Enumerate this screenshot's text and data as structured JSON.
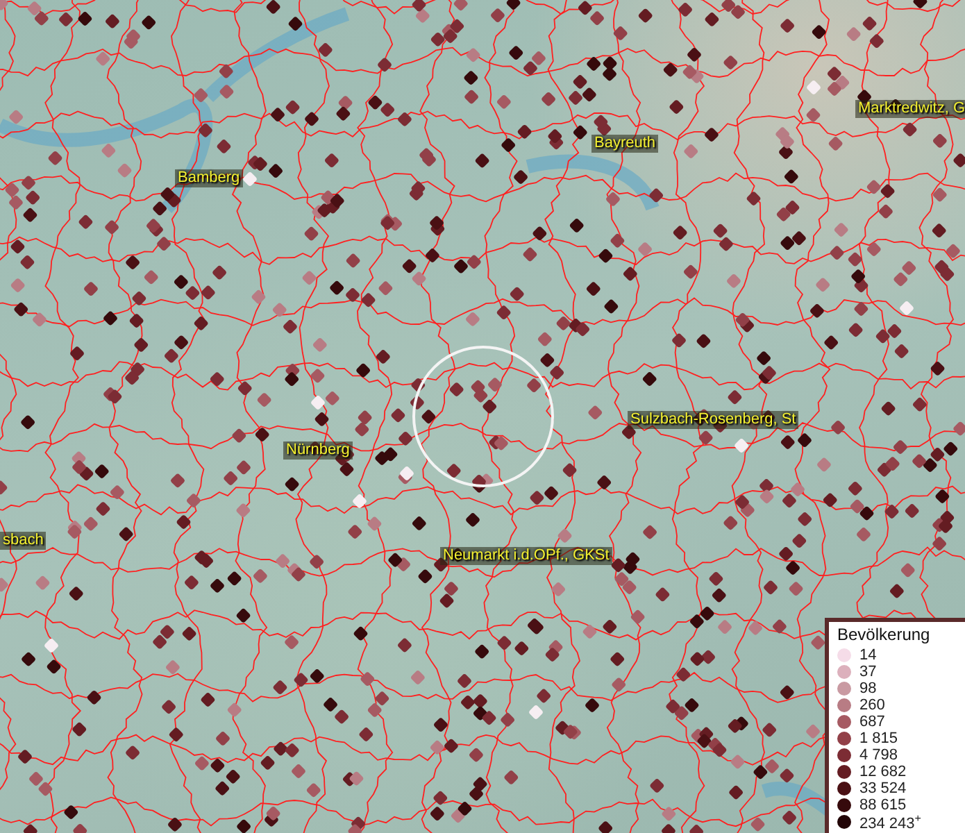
{
  "map": {
    "places": [
      {
        "name": "Marktredwitz, G"
      },
      {
        "name": "Bamberg"
      },
      {
        "name": "Bayreuth"
      },
      {
        "name": "Sulzbach-Rosenberg, St"
      },
      {
        "name": "Nürnberg"
      },
      {
        "name": "sbach"
      },
      {
        "name": "Neumarkt i.d.OPf., GKSt"
      }
    ]
  },
  "legend": {
    "title": "Bevölkerung",
    "items": [
      {
        "label": "14",
        "color": "#f5dce8"
      },
      {
        "label": "37",
        "color": "#dcb0bc"
      },
      {
        "label": "98",
        "color": "#c99aa2"
      },
      {
        "label": "260",
        "color": "#b87c84"
      },
      {
        "label": "687",
        "color": "#a65a62"
      },
      {
        "label": "1 815",
        "color": "#924048"
      },
      {
        "label": "4 798",
        "color": "#7c2c34"
      },
      {
        "label": "12 682",
        "color": "#641c22"
      },
      {
        "label": "33 524",
        "color": "#4a1014"
      },
      {
        "label": "88 615",
        "color": "#360a0c"
      },
      {
        "label": "234 243$^{+}$",
        "color": "#220406"
      }
    ]
  }
}
